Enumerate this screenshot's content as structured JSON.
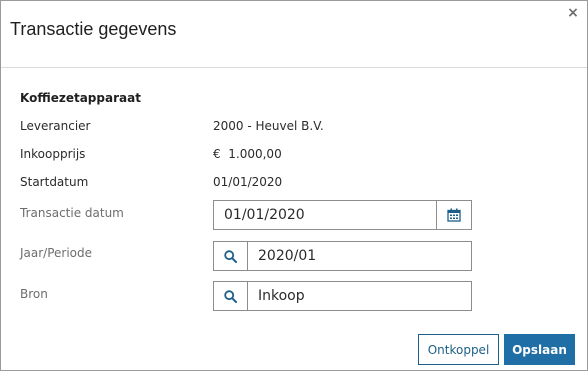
{
  "dialog": {
    "title": "Transactie gegevens",
    "close_glyph": "×"
  },
  "details": {
    "section_title": "Koffiezetapparaat",
    "rows": [
      {
        "label": "Leverancier",
        "value": "2000 - Heuvel B.V."
      },
      {
        "label": "Inkoopprijs",
        "value": "€  1.000,00"
      },
      {
        "label": "Startdatum",
        "value": "01/01/2020"
      }
    ]
  },
  "form": {
    "transactie_datum": {
      "label": "Transactie datum",
      "value": "01/01/2020",
      "icon": "calendar-icon"
    },
    "jaar_periode": {
      "label": "Jaar/Periode",
      "value": "2020/01",
      "icon": "search-icon"
    },
    "bron": {
      "label": "Bron",
      "value": "Inkoop",
      "icon": "search-icon"
    }
  },
  "buttons": {
    "ontkoppel": "Ontkoppel",
    "opslaan": "Opslaan"
  },
  "colors": {
    "accent": "#1f6ea6",
    "icon": "#1d5f88"
  }
}
